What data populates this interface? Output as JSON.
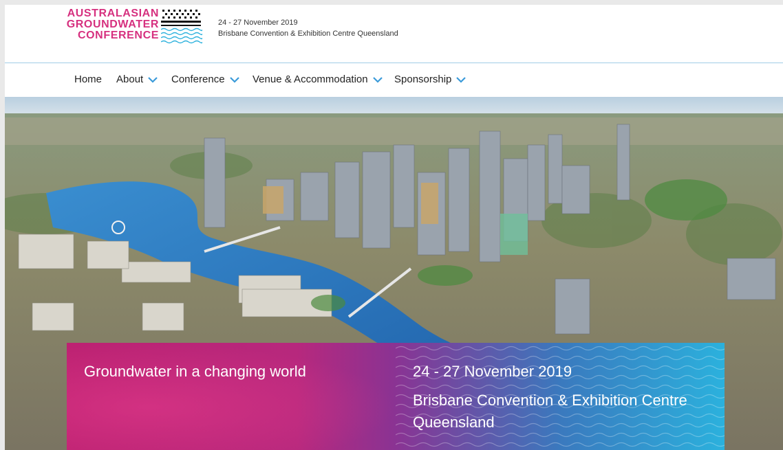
{
  "logo": {
    "line1": "AUSTRALASIAN",
    "line2": "GROUNDWATER",
    "line3": "CONFERENCE"
  },
  "header": {
    "date": "24 - 27 November 2019",
    "venue": "Brisbane Convention & Exhibition Centre Queensland"
  },
  "nav": {
    "items": [
      {
        "label": "Home",
        "has_dropdown": false
      },
      {
        "label": "About",
        "has_dropdown": true
      },
      {
        "label": "Conference",
        "has_dropdown": true
      },
      {
        "label": "Venue & Accommodation",
        "has_dropdown": true
      },
      {
        "label": "Sponsorship",
        "has_dropdown": true
      }
    ]
  },
  "hero": {
    "image_description": "aerial-city-river-photo"
  },
  "banner": {
    "tagline": "Groundwater in a changing world",
    "date": "24 - 27 November 2019",
    "venue": "Brisbane Convention & Exhibition Centre Queensland"
  },
  "colors": {
    "brand_pink": "#d6307f",
    "brand_blue": "#2bb1dd",
    "chevron_blue": "#3a9ad9"
  }
}
